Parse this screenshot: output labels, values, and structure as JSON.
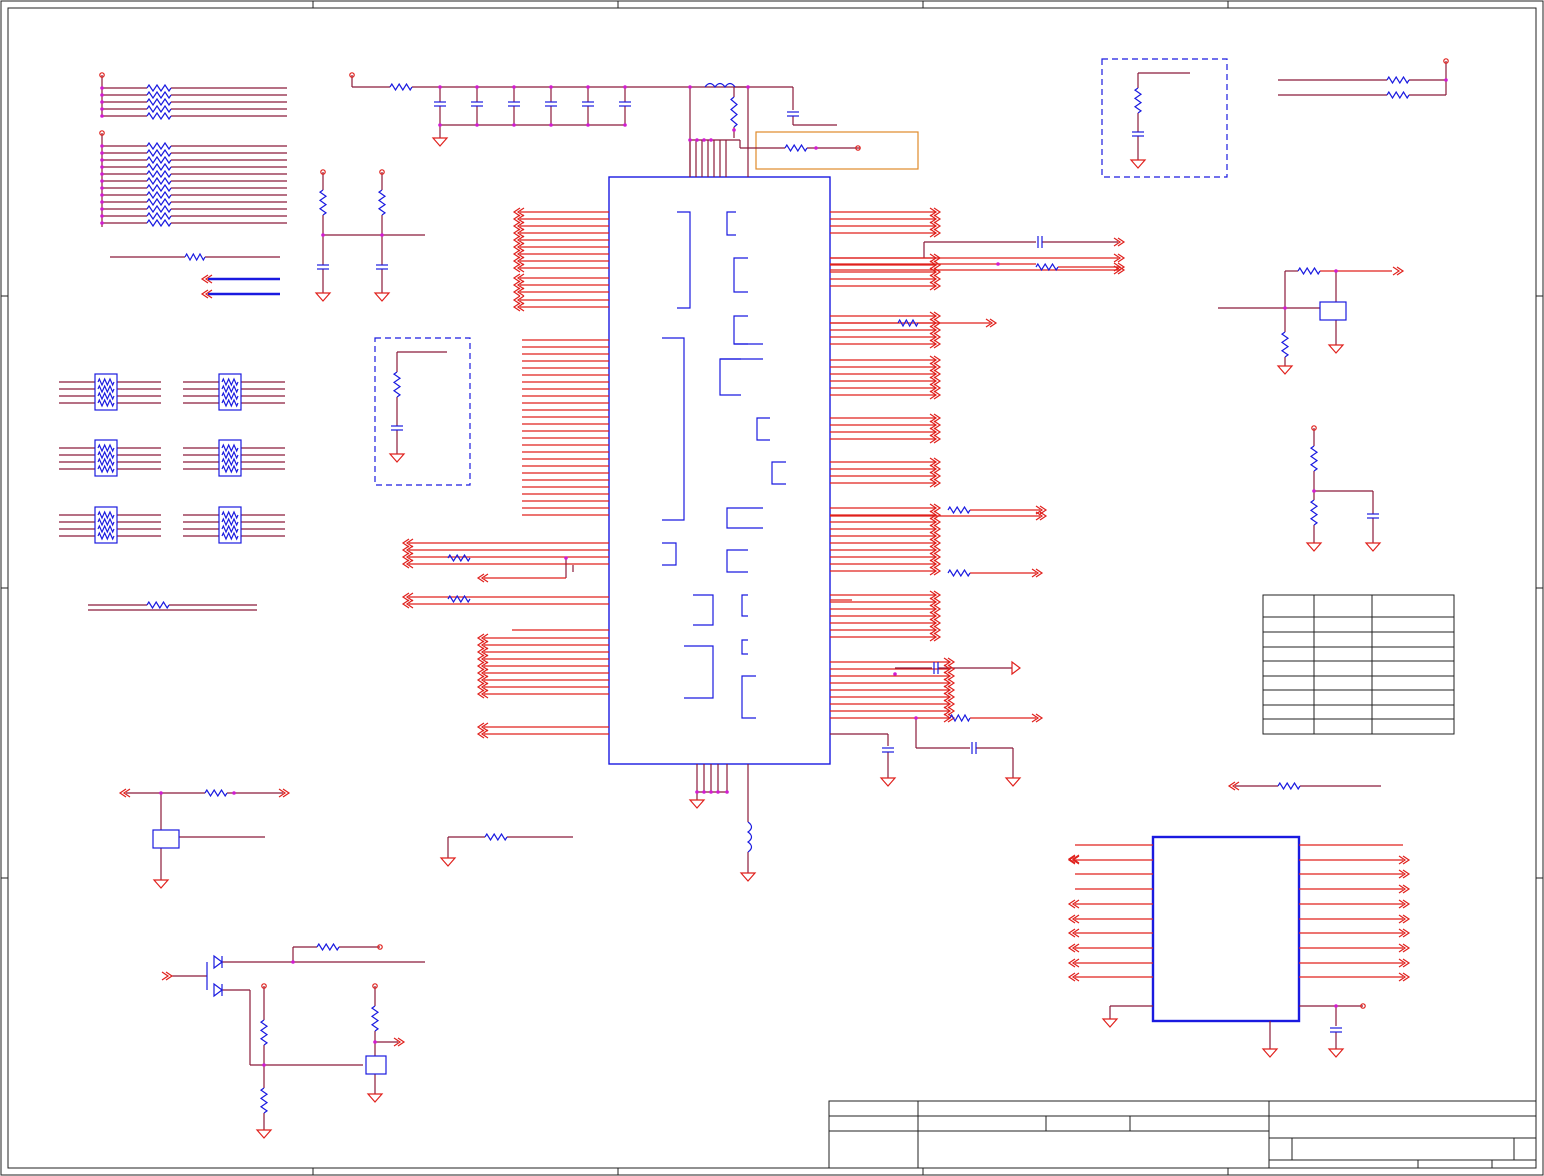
{
  "title_block": {
    "cells": [
      "",
      "",
      "",
      "",
      "",
      "",
      "",
      "",
      ""
    ]
  },
  "pin_table": {
    "rows": 9,
    "cols": 3,
    "cells": []
  },
  "colors": {
    "wire": "#8b1a3a",
    "signal": "#e0201c",
    "component": "#1a1ae0",
    "junction": "#d21cd2",
    "highlight_box": "#e08a2a"
  }
}
